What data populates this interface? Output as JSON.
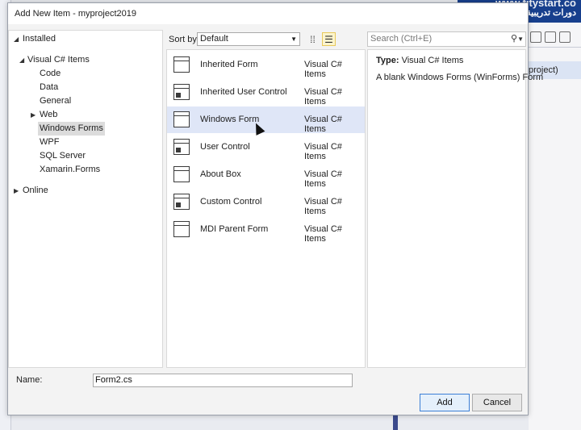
{
  "background": {
    "solution_item": "project)",
    "watermark_top": "www.fitystart.co",
    "watermark_bottom": "دورات تدريبية - حلول اعمال"
  },
  "dialog": {
    "title": "Add New Item - myproject2019",
    "close_glyph": "✕"
  },
  "tree": {
    "installed": "Installed",
    "visual_csharp_items": "Visual C# Items",
    "children": [
      "Code",
      "Data",
      "General",
      "Web",
      "Windows Forms",
      "WPF",
      "SQL Server",
      "Xamarin.Forms"
    ],
    "selected": "Windows Forms",
    "online": "Online"
  },
  "toolbar": {
    "sort_by_label": "Sort by:",
    "sort_value": "Default",
    "search_placeholder": "Search (Ctrl+E)"
  },
  "items": [
    {
      "name": "Inherited Form",
      "type": "Visual C# Items",
      "icon": "inherited-form-icon"
    },
    {
      "name": "Inherited User Control",
      "type": "Visual C# Items",
      "icon": "inherited-user-control-icon"
    },
    {
      "name": "Windows Form",
      "type": "Visual C# Items",
      "icon": "windows-form-icon"
    },
    {
      "name": "User Control",
      "type": "Visual C# Items",
      "icon": "user-control-icon"
    },
    {
      "name": "About Box",
      "type": "Visual C# Items",
      "icon": "about-box-icon"
    },
    {
      "name": "Custom Control",
      "type": "Visual C# Items",
      "icon": "custom-control-icon"
    },
    {
      "name": "MDI Parent Form",
      "type": "Visual C# Items",
      "icon": "mdi-parent-form-icon"
    }
  ],
  "selected_item": "Windows Form",
  "details": {
    "type_label": "Type:",
    "type_value": "Visual C# Items",
    "description": "A blank Windows Forms (WinForms) Form"
  },
  "footer": {
    "name_label": "Name:",
    "name_value": "Form2.cs",
    "add_label": "Add",
    "cancel_label": "Cancel"
  }
}
